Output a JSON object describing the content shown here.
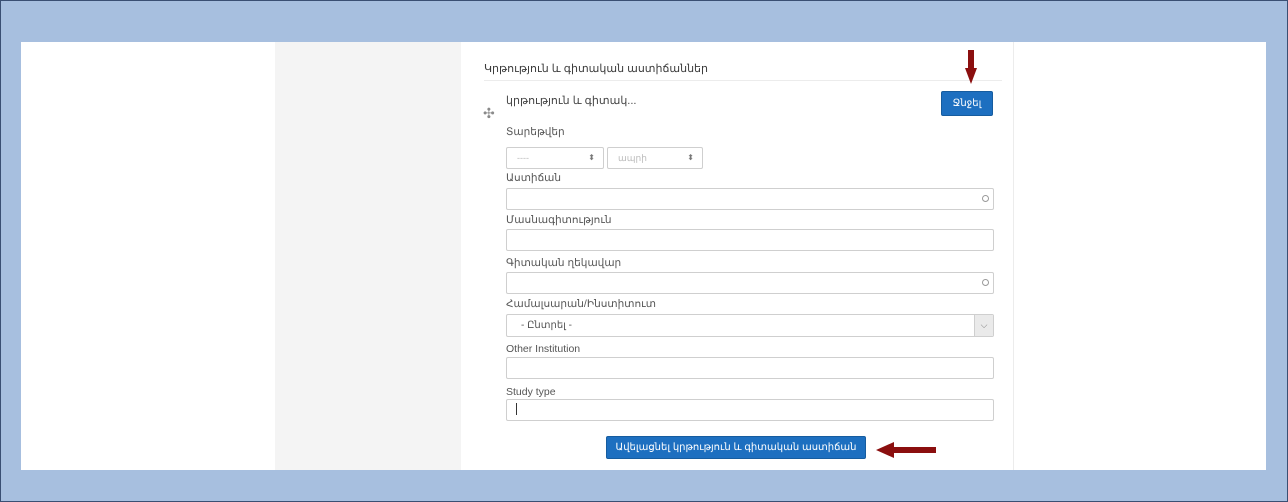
{
  "panel": {
    "title": "Կրթություն և գիտական աստիճաններ",
    "subtitle": "կրթություն և գիտակ...",
    "delete_label": "Ջնջել"
  },
  "dates": {
    "label": "Տարեթվեր",
    "year_value": "----",
    "month_value": "ապրի"
  },
  "fields": {
    "degree_label": "Աստիճան",
    "specialty_label": "Մասնագիտություն",
    "scientific_label": "Գիտական ղեկավար",
    "university_label": "Համալսարան/Ինստիտուտ",
    "university_value": "- Ընտրել -",
    "other_institution_label": "Other Institution",
    "study_type_label": "Study type"
  },
  "actions": {
    "add_label": "Ավելացնել կրթություն և գիտական աստիճան"
  },
  "icons": {
    "move": "move-icon",
    "select_arrow": "chevron-down-icon",
    "annotation_arrow": "arrow-icon"
  },
  "colors": {
    "accent": "#1d6fc0",
    "annotation": "#8b0f0f",
    "background": "#a7bfdf"
  }
}
